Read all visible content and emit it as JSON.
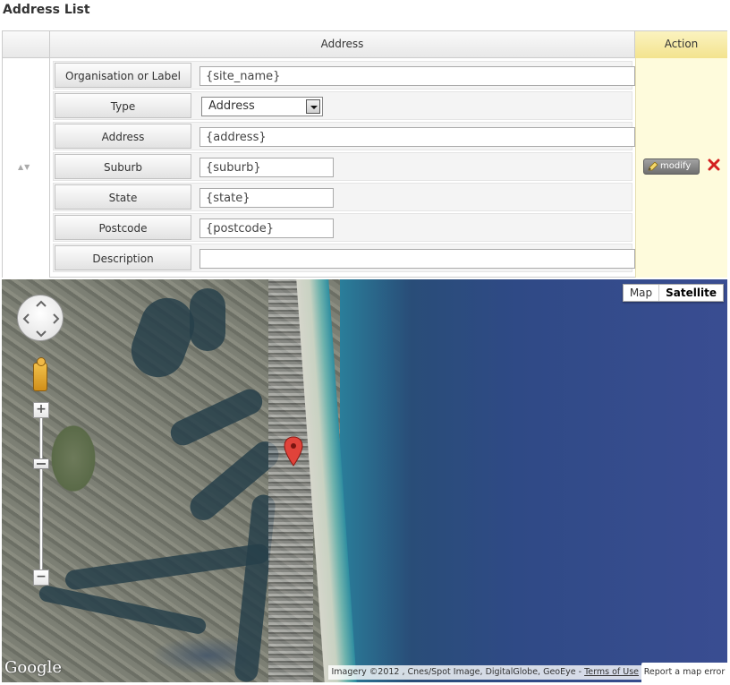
{
  "page": {
    "title": "Address List"
  },
  "table": {
    "headers": {
      "address": "Address",
      "action": "Action"
    },
    "fields": [
      {
        "label": "Organisation or Label",
        "value": "{site_name}"
      },
      {
        "label": "Type",
        "value": "Address"
      },
      {
        "label": "Address",
        "value": "{address}"
      },
      {
        "label": "Suburb",
        "value": "{suburb}"
      },
      {
        "label": "State",
        "value": "{state}"
      },
      {
        "label": "Postcode",
        "value": "{postcode}"
      },
      {
        "label": "Description",
        "value": ""
      }
    ],
    "sort_arrows": "▲▼",
    "actions": {
      "modify": "modify"
    }
  },
  "map": {
    "type_buttons": {
      "map": "Map",
      "satellite": "Satellite"
    },
    "selected_type": "Satellite",
    "google": "Google",
    "attribution": "Imagery ©2012 , Cnes/Spot Image, DigitalGlobe, GeoEye -",
    "terms": "Terms of Use",
    "report": "Report a map error"
  },
  "colors": {
    "action_bg": "#fefbdc",
    "delete": "#d32020",
    "ocean": "#3a4d92"
  }
}
